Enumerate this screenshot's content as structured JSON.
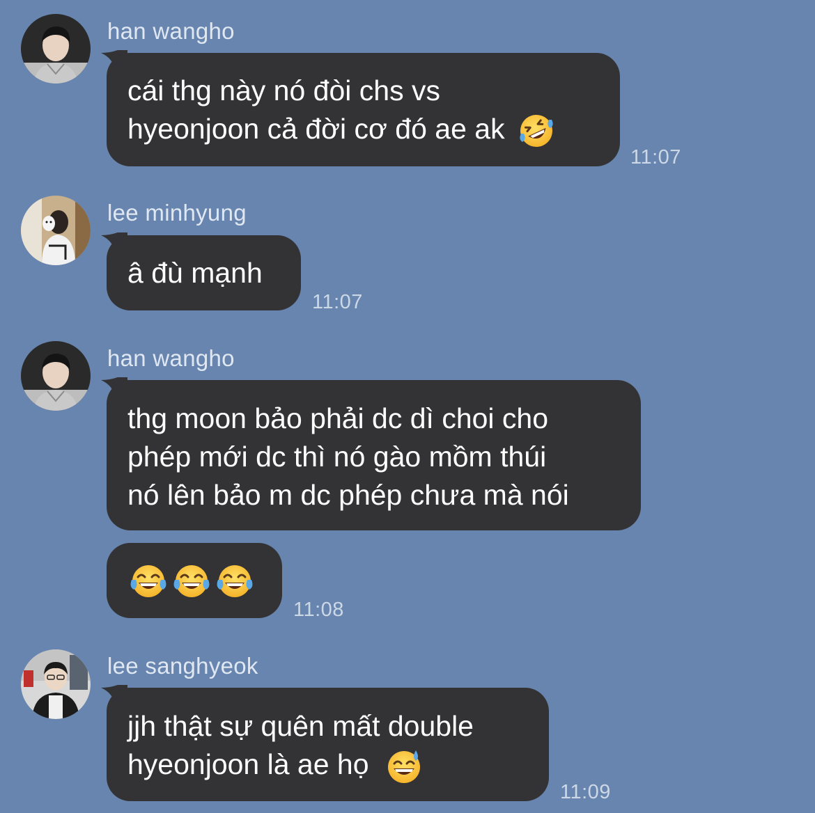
{
  "chat": {
    "groups": [
      {
        "sender": "han wangho",
        "avatar_icon": "avatar-han-wangho",
        "messages": [
          {
            "lines": [
              "cái thg này nó đòi chs vs",
              "hyeonjoon cả đời cơ đó ae ak"
            ],
            "emoji": "rofl-emoji",
            "time": "11:07"
          }
        ]
      },
      {
        "sender": "lee minhyung",
        "avatar_icon": "avatar-lee-minhyung",
        "messages": [
          {
            "lines": [
              "â đù mạnh"
            ],
            "time": "11:07"
          }
        ]
      },
      {
        "sender": "han wangho",
        "avatar_icon": "avatar-han-wangho",
        "messages": [
          {
            "lines": [
              "thg moon bảo phải dc dì choi cho",
              "phép mới dc thì nó gào mồm thúi",
              "nó lên bảo m dc phép chưa mà nói"
            ]
          },
          {
            "emojis": [
              "joy-emoji",
              "joy-emoji",
              "joy-emoji"
            ],
            "time": "11:08"
          }
        ]
      },
      {
        "sender": "lee sanghyeok",
        "avatar_icon": "avatar-lee-sanghyeok",
        "messages": [
          {
            "lines": [
              "jjh thật sự quên mất double",
              "hyeonjoon là ae họ"
            ],
            "emoji": "grin-sweat-emoji",
            "time": "11:09"
          }
        ]
      }
    ]
  },
  "colors": {
    "background": "#6785ae",
    "bubble": "#333335",
    "bubble_text": "#ffffff",
    "sender_text": "#dfe7f2",
    "time_text": "#cdd8e6",
    "emoji_face": "#fbc93e",
    "emoji_tear": "#5aa9e6"
  }
}
